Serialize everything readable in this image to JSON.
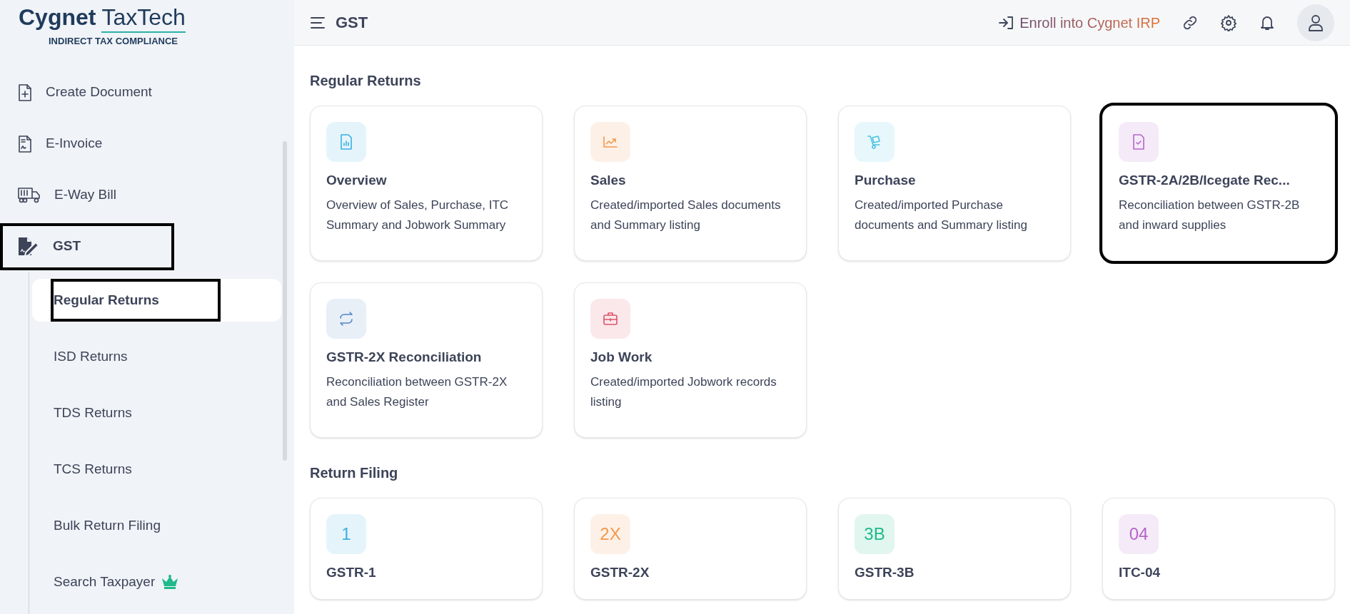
{
  "logo": {
    "brand": "Cygnet",
    "product": "TaxTech",
    "tagline": "INDIRECT TAX COMPLIANCE"
  },
  "nav": [
    {
      "label": "Create Document",
      "selected": false,
      "highlighted": false
    },
    {
      "label": "E-Invoice",
      "selected": false,
      "highlighted": false
    },
    {
      "label": "E-Way Bill",
      "selected": false,
      "highlighted": false
    },
    {
      "label": "GST",
      "selected": true,
      "highlighted": true,
      "children": [
        {
          "label": "Regular Returns",
          "selected": true,
          "highlighted": true,
          "premium": false
        },
        {
          "label": "ISD Returns",
          "selected": false,
          "highlighted": false,
          "premium": false
        },
        {
          "label": "TDS Returns",
          "selected": false,
          "highlighted": false,
          "premium": false
        },
        {
          "label": "TCS Returns",
          "selected": false,
          "highlighted": false,
          "premium": false
        },
        {
          "label": "Bulk Return Filing",
          "selected": false,
          "highlighted": false,
          "premium": false
        },
        {
          "label": "Search Taxpayer",
          "selected": false,
          "highlighted": false,
          "premium": true
        }
      ]
    }
  ],
  "header": {
    "title": "GST",
    "enroll_link": "Enroll into Cygnet IRP"
  },
  "sections": [
    {
      "title": "Regular Returns",
      "cards": [
        {
          "kind": "icon",
          "title": "Overview",
          "description": "Overview of Sales, Purchase, ITC Summary and Jobwork Summary",
          "color": "#3ab0e2",
          "highlighted": false
        },
        {
          "kind": "icon",
          "title": "Sales",
          "description": "Created/imported Sales documents and Summary listing",
          "color": "#f2994a",
          "highlighted": false
        },
        {
          "kind": "icon",
          "title": "Purchase",
          "description": "Created/imported Purchase documents and Summary listing",
          "color": "#4cc3e0",
          "highlighted": false
        },
        {
          "kind": "icon",
          "title": "GSTR-2A/2B/Icegate Rec...",
          "description": "Reconciliation between GSTR-2B and inward supplies",
          "color": "#b565c9",
          "highlighted": true
        },
        {
          "kind": "icon",
          "title": "GSTR-2X Reconciliation",
          "description": "Reconciliation between GSTR-2X and Sales Register",
          "color": "#4f86c6",
          "highlighted": false
        },
        {
          "kind": "icon",
          "title": "Job Work",
          "description": "Created/imported Jobwork records listing",
          "color": "#e0526b",
          "highlighted": false
        }
      ]
    },
    {
      "title": "Return Filing",
      "cards": [
        {
          "kind": "badge",
          "badge": "1",
          "title": "GSTR-1",
          "color": "#3ab0e2",
          "highlighted": false
        },
        {
          "kind": "badge",
          "badge": "2X",
          "title": "GSTR-2X",
          "color": "#f2994a",
          "highlighted": false
        },
        {
          "kind": "badge",
          "badge": "3B",
          "title": "GSTR-3B",
          "color": "#1fb98a",
          "highlighted": false
        },
        {
          "kind": "badge",
          "badge": "04",
          "title": "ITC-04",
          "color": "#b565c9",
          "highlighted": false
        }
      ]
    }
  ]
}
